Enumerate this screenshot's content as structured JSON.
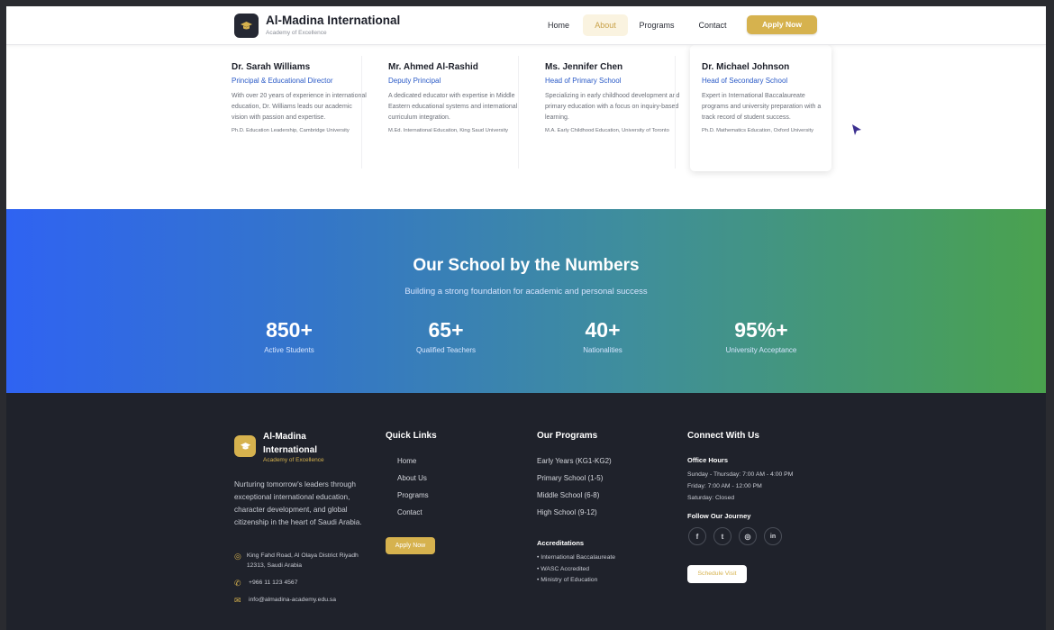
{
  "header": {
    "brand_name": "Al-Madina International",
    "brand_tagline": "Academy of Excellence",
    "nav": [
      {
        "label": "Home"
      },
      {
        "label": "About"
      },
      {
        "label": "Programs"
      },
      {
        "label": "Contact"
      }
    ],
    "active_nav": "About",
    "apply_label": "Apply Now"
  },
  "staff": [
    {
      "name": "Dr. Sarah Williams",
      "role": "Principal & Educational Director",
      "desc": "With over 20 years of experience in international education, Dr. Williams leads our academic vision with passion and expertise.",
      "credential": "Ph.D. Education Leadership, Cambridge University"
    },
    {
      "name": "Mr. Ahmed Al-Rashid",
      "role": "Deputy Principal",
      "desc": "A dedicated educator with expertise in Middle Eastern educational systems and international curriculum integration.",
      "credential": "M.Ed. International Education, King Saud University"
    },
    {
      "name": "Ms. Jennifer Chen",
      "role": "Head of Primary School",
      "desc": "Specializing in early childhood development and primary education with a focus on inquiry-based learning.",
      "credential": "M.A. Early Childhood Education, University of Toronto"
    },
    {
      "name": "Dr. Michael Johnson",
      "role": "Head of Secondary School",
      "desc": "Expert in International Baccalaureate programs and university preparation with a track record of student success.",
      "credential": "Ph.D. Mathematics Education, Oxford University"
    }
  ],
  "numbers": {
    "title": "Our School by the Numbers",
    "subtitle": "Building a strong foundation for academic and personal success",
    "stats": [
      {
        "value": "850+",
        "label": "Active Students"
      },
      {
        "value": "65+",
        "label": "Qualified Teachers"
      },
      {
        "value": "40+",
        "label": "Nationalities"
      },
      {
        "value": "95%+",
        "label": "University Acceptance"
      }
    ]
  },
  "footer": {
    "brand_name": "Al-Madina International",
    "brand_tagline": "Academy of Excellence",
    "description": "Nurturing tomorrow's leaders through exceptional international education, character development, and global citizenship in the heart of Saudi Arabia.",
    "address": "King Fahd Road, Al Olaya District Riyadh 12313, Saudi Arabia",
    "phone": "+966 11 123 4567",
    "email": "info@almadina-academy.edu.sa",
    "quick_links_heading": "Quick Links",
    "quick_links": [
      "Home",
      "About Us",
      "Programs",
      "Contact"
    ],
    "apply_label": "Apply Now",
    "programs_heading": "Our Programs",
    "programs": [
      "Early Years (KG1-KG2)",
      "Primary School (1-5)",
      "Middle School (6-8)",
      "High School (9-12)"
    ],
    "accreditations_heading": "Accreditations",
    "accreditations": [
      "• International Baccalaureate",
      "• WASC Accredited",
      "• Ministry of Education"
    ],
    "connect_heading": "Connect With Us",
    "office_hours_heading": "Office Hours",
    "office_hours": [
      "Sunday - Thursday: 7:00 AM - 4:00 PM",
      "Friday: 7:00 AM - 12:00 PM",
      "Saturday: Closed"
    ],
    "follow_heading": "Follow Our Journey",
    "social": [
      "facebook-icon",
      "twitter-icon",
      "instagram-icon",
      "linkedin-icon"
    ],
    "visit_label": "Schedule Visit"
  },
  "colors": {
    "accent_gold": "#d6b24e",
    "link_blue": "#2a5ac7",
    "footer_bg": "#1f222b",
    "gradient_start": "#2f63f2",
    "gradient_end": "#4aa24e"
  }
}
